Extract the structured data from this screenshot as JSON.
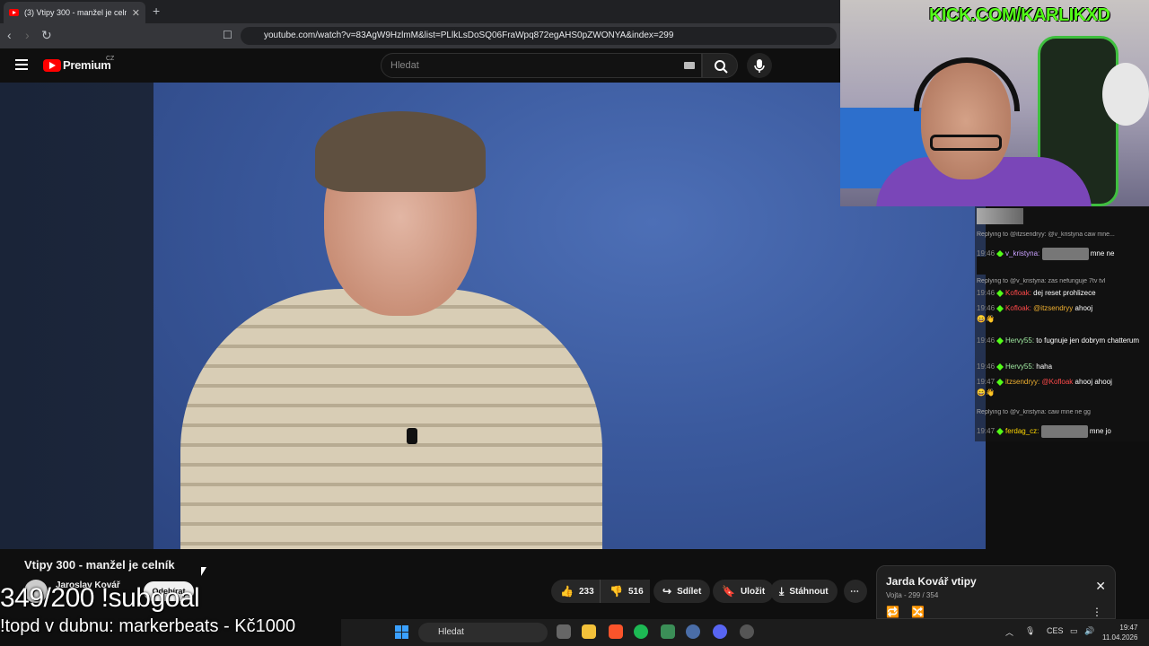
{
  "browser": {
    "tab_title": "(3) Vtipy 300 - manžel je celn",
    "tab_close": "✕",
    "new_tab": "+",
    "url": "youtube.com/watch?v=83AgW9HzlmM&list=PLlkLsDoSQ06FraWpq872egAHS0pZWONYA&index=299"
  },
  "youtube": {
    "logo_text": "Premium",
    "region": "CZ",
    "search_placeholder": "Hledat"
  },
  "video": {
    "title": "Vtipy 300 - manžel je celník",
    "channel": "Jaroslav Kovář",
    "subscribe_label": "Odebírat",
    "likes": "233",
    "dislikes": "516",
    "share_label": "Sdílet",
    "save_label": "Uložit",
    "download_label": "Stáhnout",
    "more_label": "⋯"
  },
  "playlist": {
    "title": "Jarda Kovář vtipy",
    "subtitle": "Vojta - 299 / 354",
    "close": "✕"
  },
  "stream": {
    "kick_url": "KICK.COM/KARLIKXD",
    "subgoal": "349/200 !subgoal",
    "topd": "!topd v dubnu: markerbeats - Kč1000"
  },
  "chat": [
    {
      "type": "reply",
      "text": "Replying to @itzsendryy: @v_kristyna caw mne..."
    },
    {
      "type": "msg",
      "time": "19:46",
      "user": "v_kristyna:",
      "user_color": "#c9a0ff",
      "text": "mne ne"
    },
    {
      "type": "reply",
      "text": "Replying to @v_kristyna: zas nefunguje 7tv tvl"
    },
    {
      "type": "msg",
      "time": "19:46",
      "user": "Kofloak:",
      "user_color": "#ff4a4a",
      "text": "dej reset prohlizece"
    },
    {
      "type": "msg",
      "time": "19:46",
      "user": "Kofloak:",
      "user_color": "#ff4a4a",
      "mention": "@itzsendryy",
      "text": "ahooj"
    },
    {
      "type": "msg",
      "time": "19:46",
      "user": "Hervy55:",
      "user_color": "#9fe8a0",
      "text": "to fugnuje jen dobrym chatterum"
    },
    {
      "type": "msg",
      "time": "19:46",
      "user": "Hervy55:",
      "user_color": "#9fe8a0",
      "text": "haha"
    },
    {
      "type": "msg",
      "time": "19:47",
      "user": "itzsendryy:",
      "user_color": "#f0b030",
      "mention": "@Kofloak",
      "text": "ahooj ahooj"
    },
    {
      "type": "reply",
      "text": "Replying to @v_kristyna: caw mne ne gg"
    },
    {
      "type": "msg",
      "time": "19:47",
      "user": "ferdag_cz:",
      "user_color": "#ffd700",
      "text": "mne jo"
    }
  ],
  "taskbar": {
    "search_label": "Hledat",
    "lang": "CES",
    "time": "19:47",
    "date": "11.04.2026"
  },
  "colors": {
    "kick_green": "#53fc18",
    "yt_red": "#ff0000",
    "video_blue": "#3b5a9e"
  }
}
